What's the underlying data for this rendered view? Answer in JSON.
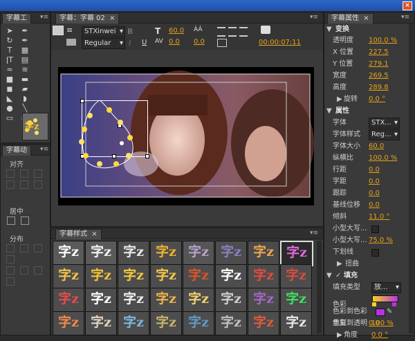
{
  "window": {
    "close": "×"
  },
  "tools": {
    "tab": "字幕工",
    "menu": "▾≡",
    "list": [
      {
        "name": "selection-tool-icon",
        "glyph": "➤"
      },
      {
        "name": "pen-tool-icon",
        "glyph": "✒"
      },
      {
        "name": "rotate-tool-icon",
        "glyph": "↻"
      },
      {
        "name": "add-anchor-tool-icon",
        "glyph": "✒"
      },
      {
        "name": "type-tool-icon",
        "glyph": "T"
      },
      {
        "name": "area-type-tool-icon",
        "glyph": "▦"
      },
      {
        "name": "vertical-type-tool-icon",
        "glyph": "ǀT"
      },
      {
        "name": "vertical-area-type-tool-icon",
        "glyph": "▤"
      },
      {
        "name": "path-type-tool-icon",
        "glyph": "≈"
      },
      {
        "name": "vertical-path-type-tool-icon",
        "glyph": "≋"
      },
      {
        "name": "rectangle-tool-icon",
        "glyph": "■"
      },
      {
        "name": "rounded-rect-tool-icon",
        "glyph": "▬"
      },
      {
        "name": "clipped-rect-tool-icon",
        "glyph": "◼"
      },
      {
        "name": "rounded-rect2-tool-icon",
        "glyph": "▰"
      },
      {
        "name": "wedge-tool-icon",
        "glyph": "◣"
      },
      {
        "name": "arc-tool-icon",
        "glyph": "◗"
      },
      {
        "name": "ellipse-tool-icon",
        "glyph": "●"
      },
      {
        "name": "line-tool-icon",
        "glyph": "╲"
      },
      {
        "name": "frame-tool-icon",
        "glyph": "▭"
      },
      {
        "name": "frame2-tool-icon",
        "glyph": "▢"
      },
      {
        "name": "pen-curve-tool-icon",
        "glyph": "↯"
      },
      {
        "name": "pointer-tool-icon",
        "glyph": "✎"
      }
    ],
    "preview_text": "字z"
  },
  "actions": {
    "tab": "字幕动",
    "menu": "▾≡",
    "align_label": "对齐",
    "center_label": "居中",
    "distribute_label": "分布"
  },
  "title": {
    "tab": "字幕：字幕 02",
    "close": "×",
    "menu": "▾≡",
    "font": "STXinwei",
    "style": "Regular",
    "font_size": "60.0",
    "kerning": "0.0",
    "tracking": "0.0",
    "timecode": "00:00:07:11",
    "bold": "B",
    "italic": "I",
    "underline": "U"
  },
  "styles": {
    "tab": "字幕样式",
    "close": "×",
    "menu": "▾≡",
    "sample": "字z",
    "rows": [
      [
        {
          "fg": "#ffffff",
          "bg": "#5a5a5a"
        },
        {
          "fg": "#f2f2f2",
          "bg": "#5a5a5a"
        },
        {
          "fg": "#e8e8e8",
          "bg": "#4d4d4d"
        },
        {
          "fg": "#f1b233",
          "bg": "#4d4d4d"
        },
        {
          "fg": "#b7a1c8",
          "bg": "#555"
        },
        {
          "fg": "#8e7fc2",
          "bg": "#4d4d4d"
        },
        {
          "fg": "#f0a54a",
          "bg": "#4a4a4a"
        },
        {
          "fg": "#e06ad9",
          "bg": "#2a2a2a"
        }
      ],
      [
        {
          "fg": "#f3c24a",
          "bg": "#4d4d4d"
        },
        {
          "fg": "#f2c13a",
          "bg": "#4d4d4d"
        },
        {
          "fg": "#f5c93e",
          "bg": "#4d4d4d"
        },
        {
          "fg": "#f3c84b",
          "bg": "#4d4d4d"
        },
        {
          "fg": "#d8572a",
          "bg": "#4d4d4d"
        },
        {
          "fg": "#ffffff",
          "bg": "#4d4d4d"
        },
        {
          "fg": "#e84a3a",
          "bg": "#4d4d4d"
        },
        {
          "fg": "#d94b3f",
          "bg": "#4d4d4d"
        }
      ],
      [
        {
          "fg": "#ea4b4b",
          "bg": "#4d4d4d"
        },
        {
          "fg": "#ffffff",
          "bg": "#4d4d4d"
        },
        {
          "fg": "#f0f0f0",
          "bg": "#4d4d4d"
        },
        {
          "fg": "#f3b24c",
          "bg": "#4d4d4d"
        },
        {
          "fg": "#f1d26c",
          "bg": "#4d4d4d"
        },
        {
          "fg": "#d0d0d0",
          "bg": "#4d4d4d"
        },
        {
          "fg": "#a667c9",
          "bg": "#4d4d4d"
        },
        {
          "fg": "#40e060",
          "bg": "#4d4d4d"
        }
      ],
      [
        {
          "fg": "#f08a4a",
          "bg": "#4d4d4d"
        },
        {
          "fg": "#e0d0c0",
          "bg": "#4d4d4d"
        },
        {
          "fg": "#7fb6e0",
          "bg": "#4d4d4d"
        },
        {
          "fg": "#c8b46a",
          "bg": "#4d4d4d"
        },
        {
          "fg": "#5f9ac7",
          "bg": "#4d4d4d"
        },
        {
          "fg": "#c0c0c0",
          "bg": "#4d4d4d"
        },
        {
          "fg": "#e05a3a",
          "bg": "#4d4d4d"
        },
        {
          "fg": "#e8e8e8",
          "bg": "#4d4d4d"
        }
      ]
    ]
  },
  "props": {
    "tab": "字幕属性",
    "close": "×",
    "menu": "▾≡",
    "transform": "变换",
    "opacity_label": "透明度",
    "opacity": "100.0 %",
    "x_label": "X 位置",
    "x": "227.5",
    "y_label": "Y 位置",
    "y": "279.1",
    "width_label": "宽度",
    "width": "269.5",
    "height_label": "高度",
    "height": "289.8",
    "rotation_label": "旋转",
    "rotation": "0.0 °",
    "attributes": "属性",
    "font_label": "字体",
    "font": "STX...",
    "font_style_label": "字体样式",
    "font_style": "Reg...",
    "font_size_label": "字体大小",
    "font_size": "60.0",
    "aspect_label": "纵横比",
    "aspect": "100.0 %",
    "leading_label": "行距",
    "leading": "0.0",
    "kerning_label": "字距",
    "kerning": "0.0",
    "tracking_label": "跟踪",
    "tracking": "0.0",
    "baseline_label": "基线位移",
    "baseline": "0.0",
    "slant_label": "倾斜",
    "slant": "11.0 °",
    "smallcaps_label": "小型大写...",
    "smallcaps_size_label": "小型大写...",
    "smallcaps_size": "75.0 %",
    "underline_label": "下划线",
    "distort_label": "扭曲",
    "fill_label": "填充",
    "fill_type_label": "填充类型",
    "fill_type": "放...",
    "color_label": "色彩",
    "color_to_color_label": "色彩到色彩",
    "color_to_opacity_label": "色彩到透明",
    "color_to_opacity": "100 %",
    "angle_label": "角度",
    "angle": "0.0 °",
    "repeat_label": "重复",
    "repeat": "0.0"
  }
}
